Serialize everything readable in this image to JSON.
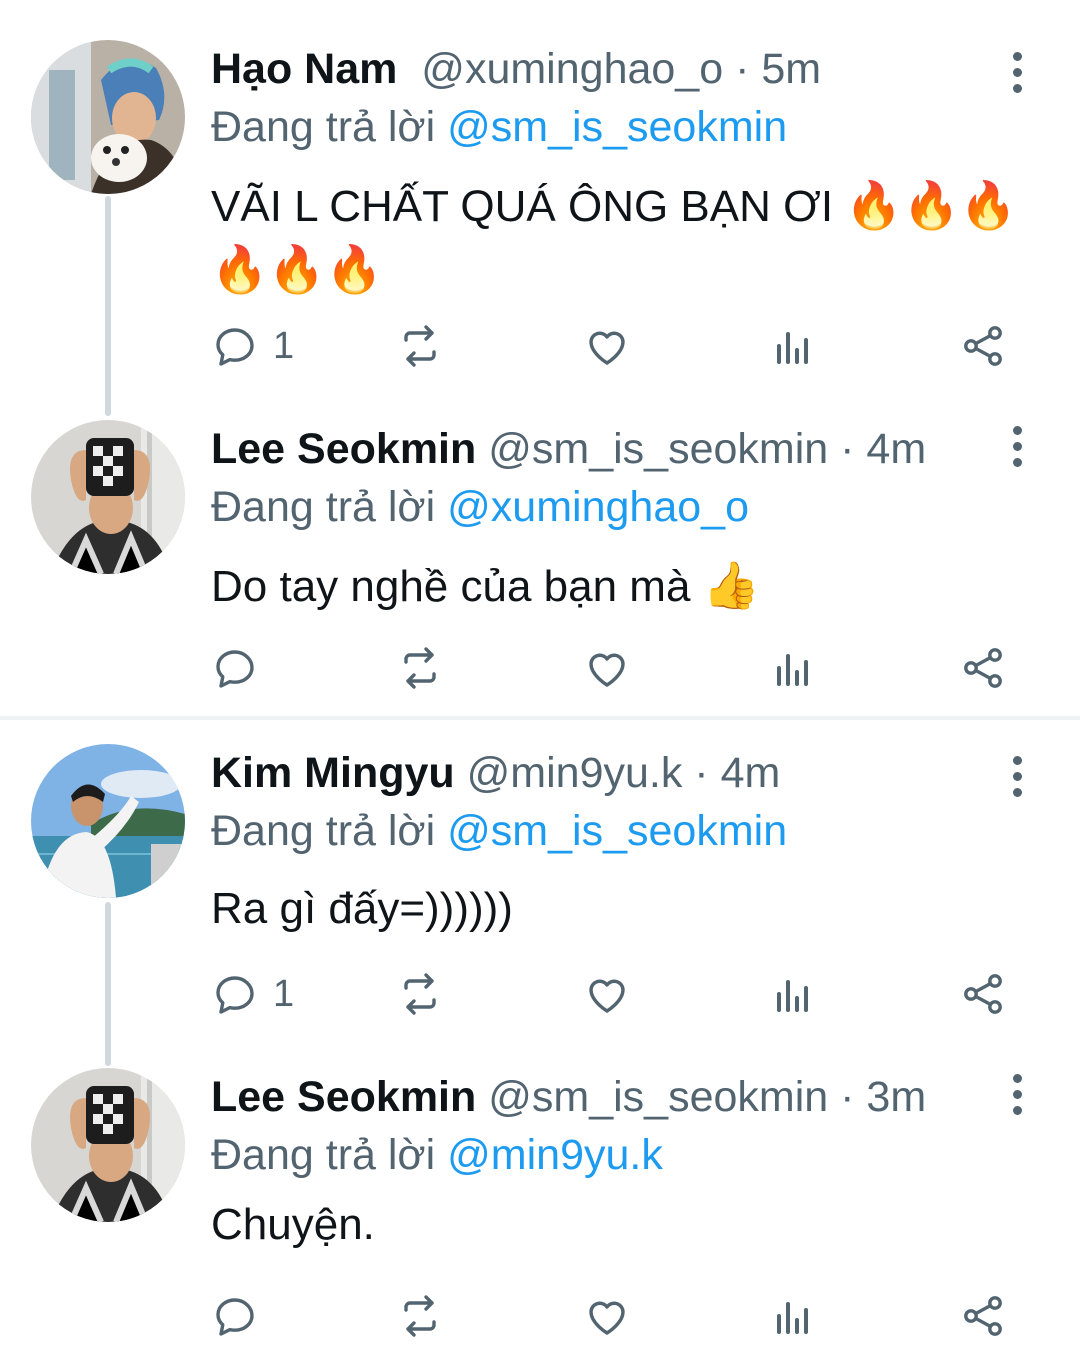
{
  "colors": {
    "accent": "#1d9bf0",
    "secondary_text": "#536471",
    "thread_line": "#cfd9de",
    "divider": "#eff3f4"
  },
  "replying_prefix": "Đang trả lời",
  "tweets": [
    {
      "name": "Hạo Nam",
      "handle": "@xuminghao_o",
      "time": "5m",
      "reply_to": "@sm_is_seokmin",
      "text": "VÃI L CHẤT QUÁ ÔNG BẠN ƠI",
      "emoji_line1": "🔥🔥🔥",
      "emoji_line2": "🔥🔥🔥",
      "reply_count": "1",
      "icons": [
        "comment-icon",
        "retweet-icon",
        "heart-icon",
        "analytics-icon",
        "share-icon",
        "more-icon"
      ]
    },
    {
      "name": "Lee Seokmin",
      "handle": "@sm_is_seokmin",
      "time": "4m",
      "reply_to": "@xuminghao_o",
      "text": "Do tay nghề của bạn mà",
      "emoji": "👍",
      "reply_count": ""
    },
    {
      "name": "Kim Mingyu",
      "handle": "@min9yu.k",
      "time": "4m",
      "reply_to": "@sm_is_seokmin",
      "text": "Ra gì đấy=))))))",
      "reply_count": "1"
    },
    {
      "name": "Lee Seokmin",
      "handle": "@sm_is_seokmin",
      "time": "3m",
      "reply_to": "@min9yu.k",
      "text": "Chuyện.",
      "reply_count": ""
    }
  ]
}
